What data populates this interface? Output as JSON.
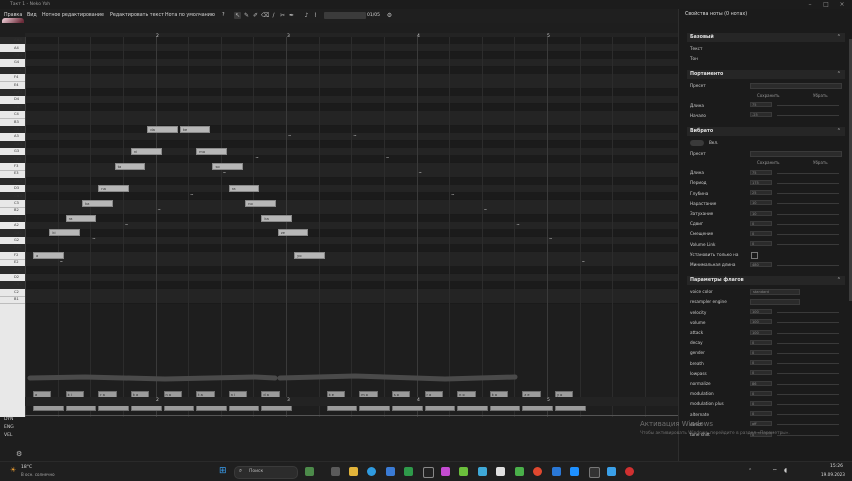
{
  "window": {
    "title": "Такт 1 - Neko Yoh",
    "controls": [
      "–",
      "□",
      "×"
    ]
  },
  "menubar": {
    "items": [
      "Правка",
      "Вид",
      "Нотное редактирование",
      "Редактировать текст",
      "Нота по умолчанию",
      "?"
    ],
    "bar_counter": "01/05"
  },
  "ruler": {
    "numbers": [
      "2",
      "3",
      "4",
      "5"
    ],
    "start_label": "120.00\n4/4"
  },
  "piano_labels": [
    "A#4",
    "A4",
    "G#4",
    "G4",
    "F#4",
    "F4",
    "E4",
    "D#4",
    "D4",
    "C#4",
    "C4",
    "B3",
    "A#3",
    "A3",
    "G#3",
    "G3",
    "F#3",
    "F3",
    "E3",
    "D#3",
    "D3",
    "C#3",
    "C3",
    "B2",
    "A#2",
    "A2",
    "G#2",
    "G2",
    "F#2",
    "F2",
    "E2",
    "D#2",
    "D2",
    "C#2",
    "C2",
    "B1"
  ],
  "notes": [
    {
      "lyric": "a",
      "pitch_row": 29,
      "start": 0.0,
      "len": 0.5
    },
    {
      "lyric": "ki",
      "pitch_row": 26,
      "start": 0.5,
      "len": 0.5
    },
    {
      "lyric": "ra",
      "pitch_row": 24,
      "start": 1.0,
      "len": 0.5
    },
    {
      "lyric": "ka",
      "pitch_row": 22,
      "start": 1.5,
      "len": 0.5
    },
    {
      "lyric": "na",
      "pitch_row": 20,
      "start": 2.0,
      "len": 0.5
    },
    {
      "lyric": "ta",
      "pitch_row": 17,
      "start": 2.5,
      "len": 0.5
    },
    {
      "lyric": "ni",
      "pitch_row": 15,
      "start": 3.0,
      "len": 0.5
    },
    {
      "lyric": "da",
      "pitch_row": 12,
      "start": 3.5,
      "len": 0.5
    },
    {
      "lyric": "ke",
      "pitch_row": 12,
      "start": 4.5,
      "len": 0.5
    },
    {
      "lyric": "mo",
      "pitch_row": 15,
      "start": 5.0,
      "len": 0.5
    },
    {
      "lyric": "so",
      "pitch_row": 17,
      "start": 5.5,
      "len": 0.5
    },
    {
      "lyric": "ra",
      "pitch_row": 20,
      "start": 6.0,
      "len": 0.5
    },
    {
      "lyric": "no",
      "pitch_row": 22,
      "start": 6.5,
      "len": 0.5
    },
    {
      "lyric": "ka",
      "pitch_row": 24,
      "start": 7.0,
      "len": 0.5
    },
    {
      "lyric": "ze",
      "pitch_row": 26,
      "start": 7.5,
      "len": 0.5
    },
    {
      "lyric": "yo",
      "pitch_row": 29,
      "start": 8.0,
      "len": 0.5
    }
  ],
  "phonemes": [
    "a",
    "k i",
    "r a",
    "k a",
    "n a",
    "t a",
    "n i",
    "d a",
    "k e",
    "m o",
    "s o",
    "r a",
    "n o",
    "k a",
    "z e",
    "y o"
  ],
  "lanes": [
    "DYN",
    "ENG",
    "VEL"
  ],
  "panel": {
    "title": "Свойства ноты (0 нотах)",
    "sections": [
      {
        "name": "Базовый",
        "rows": [
          {
            "label": "Текст"
          },
          {
            "label": "Тон"
          }
        ]
      },
      {
        "name": "Портаменто",
        "rows": [
          {
            "label": "Пресет"
          },
          {
            "label": "Длина",
            "value": "75"
          },
          {
            "label": "Начало",
            "value": "-25"
          }
        ],
        "buttons": [
          "Сохранить",
          "Убрать"
        ]
      },
      {
        "name": "Вибрато",
        "toggle": "Вкл.",
        "rows": [
          {
            "label": "Пресет"
          },
          {
            "label": "Длина",
            "value": "75"
          },
          {
            "label": "Период",
            "value": "175"
          },
          {
            "label": "Глубина",
            "value": "25"
          },
          {
            "label": "Нарастание",
            "value": "10"
          },
          {
            "label": "Затухание",
            "value": "10"
          },
          {
            "label": "Сдвиг",
            "value": "0"
          },
          {
            "label": "Смещение",
            "value": "0"
          },
          {
            "label": "Volume Link",
            "value": "0"
          },
          {
            "label": "Установить только на"
          },
          {
            "label": "Минимальная длина",
            "value": "480"
          }
        ],
        "buttons": [
          "Сохранить",
          "Убрать"
        ]
      },
      {
        "name": "Параметры флагов",
        "rows": [
          {
            "label": "voice color",
            "value": "standard"
          },
          {
            "label": "resampler engine"
          },
          {
            "label": "velocity",
            "value": "100"
          },
          {
            "label": "volume",
            "value": "100"
          },
          {
            "label": "attack",
            "value": "100"
          },
          {
            "label": "decay",
            "value": "0"
          },
          {
            "label": "gender",
            "value": "0"
          },
          {
            "label": "breath",
            "value": "0"
          },
          {
            "label": "lowpass",
            "value": "0"
          },
          {
            "label": "normalize",
            "value": "86"
          },
          {
            "label": "modulation",
            "value": "0"
          },
          {
            "label": "modulation plus",
            "value": "0"
          },
          {
            "label": "alternate",
            "value": "0"
          },
          {
            "label": "direct",
            "value": "off"
          },
          {
            "label": "tone shift",
            "value": "0"
          }
        ]
      }
    ]
  },
  "watermark": {
    "title": "Активация Windows",
    "subtitle": "Чтобы активировать Windows, перейдите в раздел «Параметры»."
  },
  "taskbar": {
    "weather_temp": "18°C",
    "weather_desc": "В осн. солнечно",
    "search": "Поиск",
    "time": "15:26",
    "date": "19.09.2023"
  },
  "colors": {
    "note_fill": "#b7b7b7",
    "accent": "#0078d4",
    "panel_bg": "#1b1b1b"
  }
}
